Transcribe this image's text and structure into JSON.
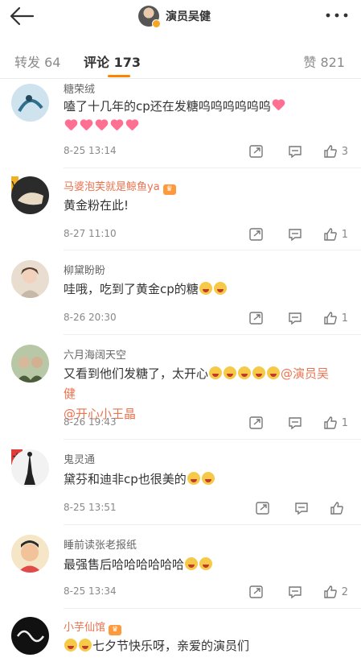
{
  "header": {
    "title": "演员吴健",
    "back_icon": "back-arrow-icon",
    "more_icon": "more-dots-icon"
  },
  "tabs": {
    "repost": "转发 64",
    "comment": "评论 173",
    "like": "赞 821",
    "accent": "#ff8200"
  },
  "comments": [
    {
      "user": "糖荣绒",
      "content": "嗑了十几年的cp还在发糖呜呜呜呜呜呜",
      "emoji": "heart x6",
      "time": "8-25 13:14",
      "likes": "3"
    },
    {
      "user": "马婆泡芙就是鲸鱼ya",
      "content": "黄金粉在此!",
      "time": "8-27 11:10",
      "likes": "1"
    },
    {
      "user": "柳黛盼盼",
      "content": "哇哦，吃到了黄金cp的糖",
      "time": "8-26 20:30",
      "likes": "1"
    },
    {
      "user": "六月海阔天空",
      "content_a": "又看到他们发糖了，太开心",
      "mention_1": "@演员吴健",
      "mention_2": "@开心小王晶",
      "time": "8-26 19:43",
      "likes": "1"
    },
    {
      "user": "鬼灵通",
      "content": "黛芬和迪非cp也很美的",
      "time": "8-25 13:51",
      "likes": ""
    },
    {
      "user": "睡前读张老报纸",
      "content": "最强售后哈哈哈哈哈哈",
      "time": "8-25 13:34",
      "likes": "2"
    },
    {
      "user": "小芋仙馆",
      "content": "七夕节快乐呀，亲爱的演员们"
    }
  ],
  "colors": {
    "vip_name": "#eb7350",
    "mention": "#eb7350",
    "meta": "#888888"
  }
}
